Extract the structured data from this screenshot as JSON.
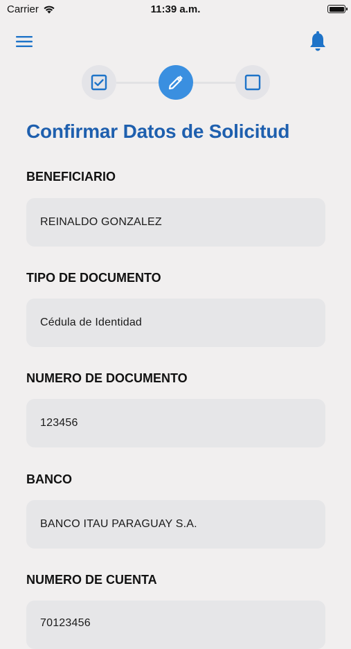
{
  "status_bar": {
    "carrier": "Carrier",
    "time": "11:39 a.m."
  },
  "header": {
    "menu_icon": "hamburger-menu-icon",
    "notification_icon": "bell-icon",
    "accent_color": "#1e73c8"
  },
  "stepper": {
    "steps": [
      {
        "icon": "checkbox-checked-icon",
        "state": "completed"
      },
      {
        "icon": "pencil-icon",
        "state": "current"
      },
      {
        "icon": "checkbox-empty-icon",
        "state": "pending"
      }
    ],
    "active_color": "#3a8fe0"
  },
  "page": {
    "title": "Confirmar Datos de Solicitud"
  },
  "fields": [
    {
      "label": "BENEFICIARIO",
      "value": "REINALDO GONZALEZ"
    },
    {
      "label": "TIPO DE DOCUMENTO",
      "value": "Cédula de Identidad"
    },
    {
      "label": "NUMERO DE DOCUMENTO",
      "value": "123456"
    },
    {
      "label": "BANCO",
      "value": "BANCO ITAU PARAGUAY S.A."
    },
    {
      "label": "NUMERO DE CUENTA",
      "value": "70123456"
    }
  ]
}
